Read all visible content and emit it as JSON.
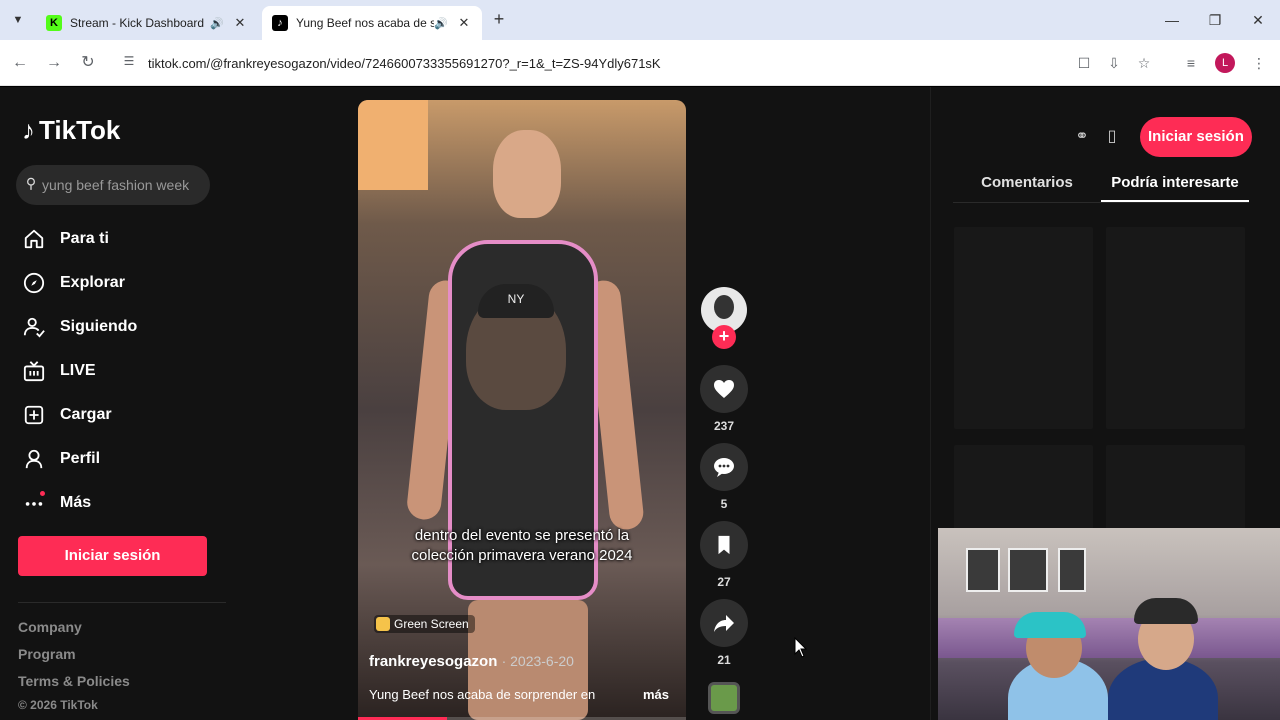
{
  "browser": {
    "tabs": [
      {
        "title": "Stream - Kick Dashboard",
        "favicon": "kick-icon"
      },
      {
        "title": "Yung Beef nos acaba de sor",
        "favicon": "tiktok-icon"
      }
    ],
    "url": "tiktok.com/@frankreyesogazon/video/7246600733355691270?_r=1&_t=ZS-94Ydly671sK",
    "profile_initial": "L"
  },
  "tiktok": {
    "logo": "TikTok",
    "search_placeholder": "yung beef fashion week",
    "nav": [
      {
        "label": "Para ti",
        "icon": "home-icon"
      },
      {
        "label": "Explorar",
        "icon": "compass-icon"
      },
      {
        "label": "Siguiendo",
        "icon": "following-icon"
      },
      {
        "label": "LIVE",
        "icon": "live-icon"
      },
      {
        "label": "Cargar",
        "icon": "upload-icon"
      },
      {
        "label": "Perfil",
        "icon": "profile-icon"
      },
      {
        "label": "Más",
        "icon": "more-icon"
      }
    ],
    "login_label": "Iniciar sesión",
    "footer": {
      "links": [
        "Company",
        "Program",
        "Terms & Policies"
      ],
      "copyright": "© 2026 TikTok"
    },
    "video": {
      "caption": "dentro del evento se presentó la colección primavera verano 2024",
      "effect_badge": "Green Screen",
      "author": "frankreyesogazon",
      "date": "2023-6-20",
      "description": "Yung Beef nos acaba de sorprender en",
      "more_label": "más",
      "pip_cap_text": "NY",
      "progress": 0.27
    },
    "actions": {
      "likes": "237",
      "comments": "5",
      "saves": "27",
      "shares": "21"
    },
    "right_panel": {
      "login_label": "Iniciar sesión",
      "tabs": [
        "Comentarios",
        "Podría interesarte"
      ],
      "active_tab": 1
    }
  },
  "colors": {
    "accent": "#fe2c55",
    "page_bg": "#121212",
    "chrome_bg": "#dfe6f5"
  }
}
